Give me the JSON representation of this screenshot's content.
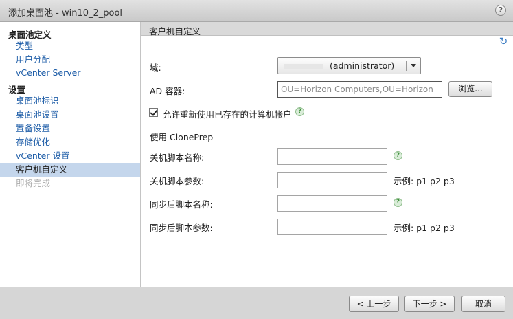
{
  "window": {
    "title": "添加桌面池 - win10_2_pool",
    "help_glyph": "?"
  },
  "sidebar": {
    "headers": [
      "桌面池定义",
      "设置"
    ],
    "items": [
      {
        "label": "类型",
        "state": "link"
      },
      {
        "label": "用户分配",
        "state": "link"
      },
      {
        "label": "vCenter Server",
        "state": "link"
      },
      {
        "label": "桌面池标识",
        "state": "link"
      },
      {
        "label": "桌面池设置",
        "state": "link"
      },
      {
        "label": "置备设置",
        "state": "link"
      },
      {
        "label": "存储优化",
        "state": "link"
      },
      {
        "label": "vCenter 设置",
        "state": "link"
      },
      {
        "label": "客户机自定义",
        "state": "selected"
      },
      {
        "label": "即将完成",
        "state": "disabled"
      }
    ]
  },
  "section": {
    "title": "客户机自定义"
  },
  "form": {
    "domain_label": "域:",
    "domain_value": "(administrator)",
    "ad_label": "AD 容器:",
    "ad_value": "OU=Horizon Computers,OU=Horizon",
    "browse_label": "浏览...",
    "reuse_label": "允许重新使用已存在的计算机帐户",
    "reuse_checked": true,
    "cloneprep_label": "使用 ClonePrep",
    "shutdown_script_label": "关机脚本名称:",
    "shutdown_params_label": "关机脚本参数:",
    "sync_script_label": "同步后脚本名称:",
    "sync_params_label": "同步后脚本参数:",
    "params_hint": "示例: p1 p2 p3",
    "help_glyph": "?"
  },
  "footer": {
    "back_label": "< 上一步",
    "next_label": "下一步 >",
    "cancel_label": "取消"
  },
  "colors": {
    "link": "#1f5ea8",
    "selected_bg": "#c4d6ec",
    "disabled": "#aaaaaa"
  }
}
